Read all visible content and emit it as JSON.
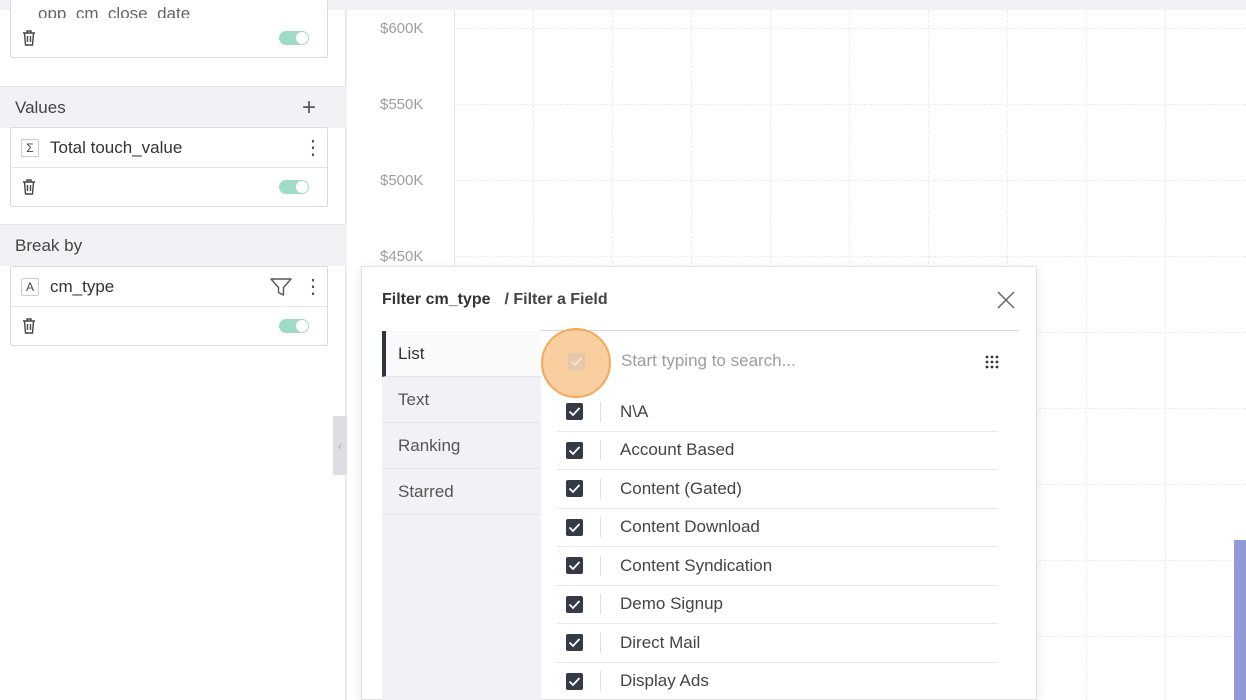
{
  "sidebar": {
    "truncated_field": "opp_cm_close_date",
    "values_section": {
      "title": "Values",
      "add_symbol": "+",
      "field": {
        "type_symbol": "Σ",
        "name": "Total touch_value"
      }
    },
    "break_by_section": {
      "title": "Break by",
      "field": {
        "type_symbol": "A",
        "name": "cm_type"
      }
    },
    "kebab_symbol": "⋮",
    "collapse_symbol": "‹"
  },
  "chart": {
    "y_ticks": [
      "$600K",
      "$550K",
      "$500K",
      "$450K"
    ]
  },
  "filter_dialog": {
    "title": "Filter cm_type",
    "subtitle": "/ Filter a Field",
    "tabs": [
      {
        "label": "List",
        "active": true
      },
      {
        "label": "Text",
        "active": false
      },
      {
        "label": "Ranking",
        "active": false
      },
      {
        "label": "Starred",
        "active": false
      }
    ],
    "search_placeholder": "Start typing to search...",
    "items": [
      {
        "label": "N\\A",
        "checked": true
      },
      {
        "label": "Account Based",
        "checked": true
      },
      {
        "label": "Content (Gated)",
        "checked": true
      },
      {
        "label": "Content Download",
        "checked": true
      },
      {
        "label": "Content Syndication",
        "checked": true
      },
      {
        "label": "Demo Signup",
        "checked": true
      },
      {
        "label": "Direct Mail",
        "checked": true
      },
      {
        "label": "Display Ads",
        "checked": true
      }
    ]
  },
  "colors": {
    "toggle_on": "#9edcc4",
    "checkbox": "#343a46",
    "highlight": "#f6b46e",
    "bar": "#8f9ad6"
  }
}
